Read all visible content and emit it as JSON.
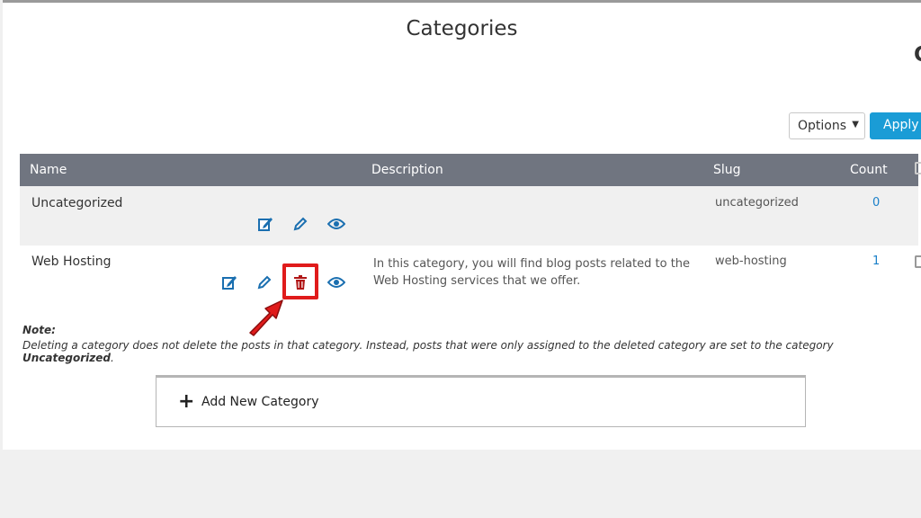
{
  "page": {
    "title": "Categories",
    "corner_text": "C"
  },
  "bulk": {
    "options_label": "Options",
    "apply_label": "Apply"
  },
  "table": {
    "headers": {
      "name": "Name",
      "description": "Description",
      "slug": "Slug",
      "count": "Count"
    },
    "rows": [
      {
        "name": "Uncategorized",
        "description": "",
        "slug": "uncategorized",
        "count": "0"
      },
      {
        "name": "Web Hosting",
        "description": "In this category, you will find blog posts related to the Web Hosting services that we offer.",
        "slug": "web-hosting",
        "count": "1"
      }
    ]
  },
  "note": {
    "title": "Note:",
    "text": "Deleting a category does not delete the posts in that category. Instead, posts that were only assigned to the deleted category are set to the category ",
    "bold": "Uncategorized",
    "end": "."
  },
  "add_category": {
    "label": "Add New Category"
  },
  "colors": {
    "accent": "#1a9cd6",
    "icon_blue": "#1a6fb0",
    "delete_red": "#b01515",
    "highlight_red": "#e01b1b",
    "header_bg": "#707580"
  },
  "icons": [
    "edit-icon",
    "pencil-icon",
    "trash-icon",
    "eye-icon",
    "plus-icon",
    "caret-down-icon",
    "arrow-pointer-icon"
  ]
}
